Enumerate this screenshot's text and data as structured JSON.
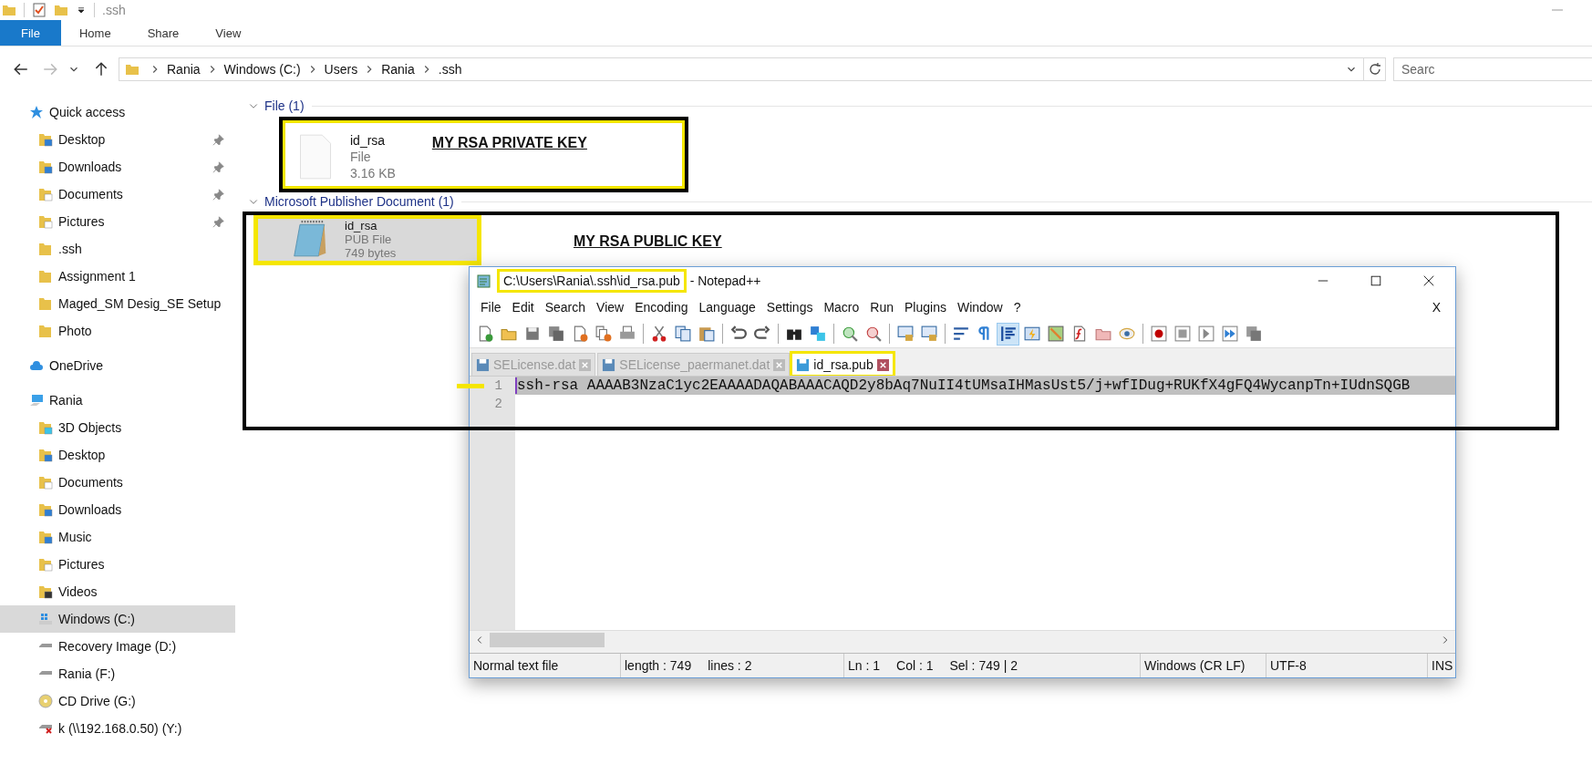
{
  "window": {
    "title": ".ssh"
  },
  "ribbon_tabs": [
    {
      "label": "File",
      "selected": true
    },
    {
      "label": "Home",
      "selected": false
    },
    {
      "label": "Share",
      "selected": false
    },
    {
      "label": "View",
      "selected": false
    }
  ],
  "address_bar": {
    "path": [
      "Rania",
      "Windows (C:)",
      "Users",
      "Rania",
      ".ssh"
    ]
  },
  "search": {
    "placeholder": "Searc"
  },
  "sidebar": {
    "items": [
      {
        "label": "Quick access",
        "kind": "star",
        "selected": false,
        "children": [
          {
            "label": "Desktop",
            "kind": "desktop",
            "pinned": true,
            "selected": false
          },
          {
            "label": "Downloads",
            "kind": "downloads",
            "pinned": true,
            "selected": false
          },
          {
            "label": "Documents",
            "kind": "documents",
            "pinned": true,
            "selected": false
          },
          {
            "label": "Pictures",
            "kind": "pictures",
            "pinned": true,
            "selected": false
          },
          {
            "label": ".ssh",
            "kind": "folder",
            "pinned": false,
            "selected": false
          },
          {
            "label": "Assignment 1",
            "kind": "folder",
            "pinned": false,
            "selected": false
          },
          {
            "label": "Maged_SM Desig_SE Setup",
            "kind": "folder",
            "pinned": false,
            "selected": false
          },
          {
            "label": "Photo",
            "kind": "folder",
            "pinned": false,
            "selected": false
          }
        ]
      },
      {
        "label": "OneDrive",
        "kind": "cloud",
        "selected": false
      },
      {
        "label": "Rania",
        "kind": "pc",
        "selected": false,
        "children": [
          {
            "label": "3D Objects",
            "kind": "objects",
            "pinned": false,
            "selected": false
          },
          {
            "label": "Desktop",
            "kind": "desktop",
            "pinned": false,
            "selected": false
          },
          {
            "label": "Documents",
            "kind": "documents",
            "pinned": false,
            "selected": false
          },
          {
            "label": "Downloads",
            "kind": "downloads",
            "pinned": false,
            "selected": false
          },
          {
            "label": "Music",
            "kind": "music",
            "pinned": false,
            "selected": false
          },
          {
            "label": "Pictures",
            "kind": "pictures",
            "pinned": false,
            "selected": false
          },
          {
            "label": "Videos",
            "kind": "videos",
            "pinned": false,
            "selected": false
          },
          {
            "label": "Windows (C:)",
            "kind": "windows-drive",
            "pinned": false,
            "selected": true
          },
          {
            "label": "Recovery Image (D:)",
            "kind": "drive",
            "pinned": false,
            "selected": false
          },
          {
            "label": "Rania (F:)",
            "kind": "drive",
            "pinned": false,
            "selected": false
          },
          {
            "label": "CD Drive (G:)",
            "kind": "cd",
            "pinned": false,
            "selected": false
          },
          {
            "label": "k (\\\\192.168.0.50) (Y:)",
            "kind": "network-drive",
            "pinned": false,
            "selected": false
          }
        ]
      }
    ]
  },
  "groups": [
    {
      "heading": "File (1)",
      "items": [
        {
          "name": "id_rsa",
          "type": "File",
          "size": "3.16 KB",
          "kind": "blank",
          "selected": false,
          "highlighted": true,
          "note": "MY RSA PRIVATE KEY"
        }
      ]
    },
    {
      "heading": "Microsoft Publisher Document (1)",
      "items": [
        {
          "name": "id_rsa",
          "type": "PUB File",
          "size": "749 bytes",
          "kind": "notepad",
          "selected": true,
          "highlighted": true
        }
      ]
    }
  ],
  "public_key_note": "MY RSA PUBLIC KEY",
  "notepad": {
    "title": "C:\\Users\\Rania\\.ssh\\id_rsa.pub",
    "title_suffix": " - Notepad++",
    "title_highlighted": true,
    "menu": [
      "File",
      "Edit",
      "Search",
      "View",
      "Encoding",
      "Language",
      "Settings",
      "Macro",
      "Run",
      "Plugins",
      "Window",
      "?"
    ],
    "close_document": "X",
    "toolbar": [
      [
        {
          "kind": "new",
          "pressed": false
        },
        {
          "kind": "open",
          "pressed": false
        },
        {
          "kind": "save",
          "pressed": false
        },
        {
          "kind": "save-all",
          "pressed": false
        },
        {
          "kind": "close",
          "pressed": false
        },
        {
          "kind": "close-all",
          "pressed": false
        },
        {
          "kind": "print",
          "pressed": false
        }
      ],
      [
        {
          "kind": "cut",
          "pressed": false
        },
        {
          "kind": "copy",
          "pressed": false
        },
        {
          "kind": "paste",
          "pressed": false
        }
      ],
      [
        {
          "kind": "undo",
          "pressed": false
        },
        {
          "kind": "redo",
          "pressed": false
        }
      ],
      [
        {
          "kind": "find",
          "pressed": false
        },
        {
          "kind": "replace",
          "pressed": false
        }
      ],
      [
        {
          "kind": "zoom-in",
          "pressed": false
        },
        {
          "kind": "zoom-out",
          "pressed": false
        }
      ],
      [
        {
          "kind": "sync-v",
          "pressed": false
        },
        {
          "kind": "sync-h",
          "pressed": false
        }
      ],
      [
        {
          "kind": "wrap",
          "pressed": false
        },
        {
          "kind": "pilcrow",
          "pressed": false
        },
        {
          "kind": "indent",
          "pressed": true
        },
        {
          "kind": "lightning",
          "pressed": false
        },
        {
          "kind": "map",
          "pressed": false
        },
        {
          "kind": "function",
          "pressed": false
        },
        {
          "kind": "workspace",
          "pressed": false
        },
        {
          "kind": "monitor",
          "pressed": false
        }
      ],
      [
        {
          "kind": "record",
          "pressed": false
        },
        {
          "kind": "stop",
          "pressed": false
        },
        {
          "kind": "play",
          "pressed": false
        },
        {
          "kind": "play-multi",
          "pressed": false
        },
        {
          "kind": "save-macro",
          "pressed": false
        }
      ]
    ],
    "tabs": [
      {
        "label": "SELicense.dat",
        "selected": false,
        "highlighted": false
      },
      {
        "label": "SELicense_paermanet.dat",
        "selected": false,
        "highlighted": false
      },
      {
        "label": "id_rsa.pub",
        "selected": true,
        "highlighted": true
      }
    ],
    "lines": [
      {
        "number": "1",
        "text": "ssh-rsa AAAAB3NzaC1yc2EAAAADAQABAAACAQD2y8bAq7NuII4tUMsaIHMasUst5/j+wfIDug+RUKfX4gFQ4WycanpTn+IUdnSQGB",
        "selected": true,
        "marked": true
      },
      {
        "number": "2",
        "selected": false,
        "marked": false
      }
    ],
    "status_bar": [
      {
        "items": [
          "Normal text file"
        ]
      },
      {
        "items": [
          "length : 749",
          "lines : 2"
        ]
      },
      {
        "items": [
          "Ln : 1",
          "Col : 1",
          "Sel : 749 | 2"
        ]
      },
      {
        "items": [
          "Windows (CR LF)"
        ]
      },
      {
        "items": [
          "UTF-8"
        ]
      },
      {
        "items": [
          "INS"
        ]
      }
    ]
  }
}
